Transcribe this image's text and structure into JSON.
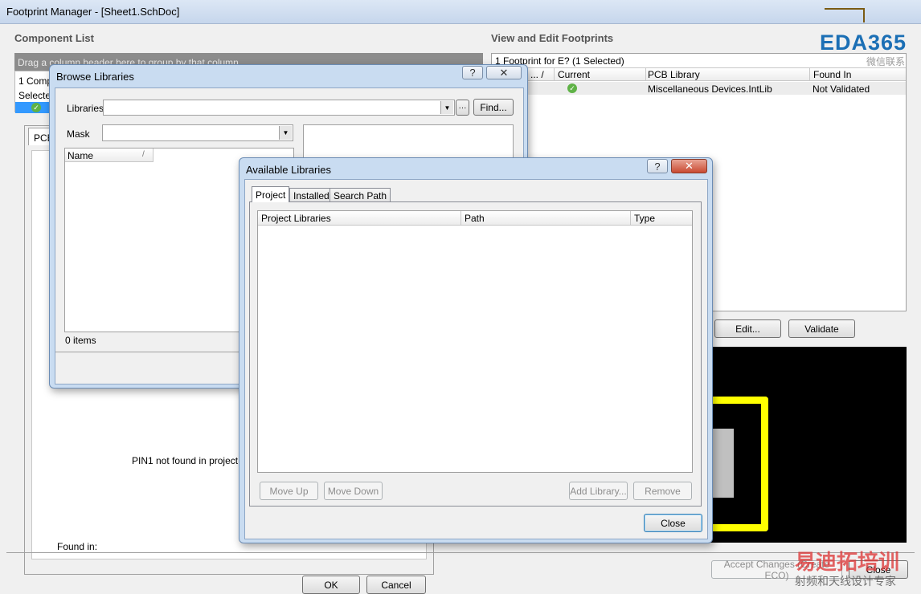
{
  "main": {
    "title": "Footprint Manager - [Sheet1.SchDoc]",
    "component_list_title": "Component List",
    "group_hint": "Drag a column header here to group by that column",
    "comp_row1": "1 Compo",
    "comp_row2": "Selected",
    "pcb_tab": "PCB",
    "pin_message": "PIN1 not found in project libr",
    "found_in": "Found in:",
    "ok": "OK",
    "cancel": "Cancel"
  },
  "footprints": {
    "title": "View and Edit Footprints",
    "summary": "1 Footprint for E? (1 Selected)",
    "columns": [
      "... /",
      "Current",
      "PCB Library",
      "Found In"
    ],
    "row": {
      "library": "Miscellaneous Devices.IntLib",
      "found_in": "Not Validated"
    },
    "edit": "Edit...",
    "validate": "Validate",
    "accept": "Accept Changes (Create ECO)",
    "close": "Close"
  },
  "browse": {
    "title": "Browse Libraries",
    "libraries_label": "Libraries",
    "ellipsis": "···",
    "find": "Find...",
    "mask_label": "Mask",
    "name_col": "Name",
    "sort_arrow": "/",
    "count": "0 items",
    "help": "?",
    "close": "✕"
  },
  "avail": {
    "title": "Available Libraries",
    "tabs": [
      "Project",
      "Installed",
      "Search Path"
    ],
    "columns": [
      "Project Libraries",
      "Path",
      "Type"
    ],
    "move_up": "Move Up",
    "move_down": "Move Down",
    "add_library": "Add Library...",
    "remove": "Remove",
    "close": "Close",
    "help": "?",
    "close_x": "✕"
  },
  "watermark": {
    "logo": "EDA365",
    "sub": "微信联系",
    "bottom1": "易迪拓培训",
    "bottom2": "射频和天线设计专家"
  },
  "colors": {
    "pcb_bg": "#000000",
    "silk": "#ffff00",
    "pad": "#c0c0c0",
    "accent": "#3399ff"
  }
}
